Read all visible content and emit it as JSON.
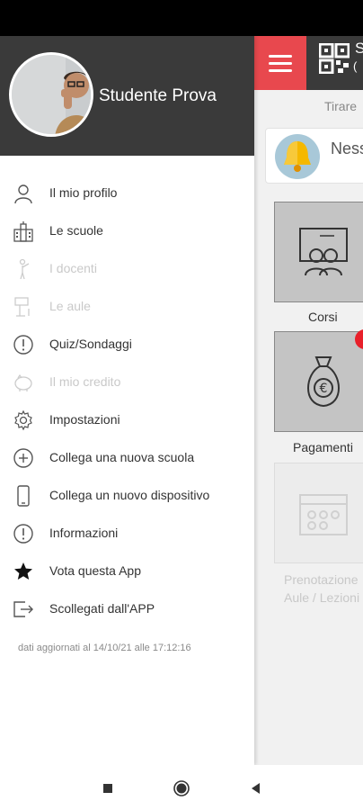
{
  "drawer": {
    "user_name": "Studente Prova",
    "items": [
      {
        "label": "Il mio profilo",
        "icon": "user-icon",
        "enabled": true
      },
      {
        "label": "Le scuole",
        "icon": "school-icon",
        "enabled": true
      },
      {
        "label": "I docenti",
        "icon": "teacher-icon",
        "enabled": false
      },
      {
        "label": "Le aule",
        "icon": "classroom-icon",
        "enabled": false
      },
      {
        "label": "Quiz/Sondaggi",
        "icon": "info-circle-icon",
        "enabled": true
      },
      {
        "label": "Il mio credito",
        "icon": "piggy-bank-icon",
        "enabled": false
      },
      {
        "label": "Impostazioni",
        "icon": "gear-icon",
        "enabled": true
      },
      {
        "label": "Collega una nuova scuola",
        "icon": "plus-circle-icon",
        "enabled": true
      },
      {
        "label": "Collega un nuovo dispositivo",
        "icon": "phone-icon",
        "enabled": true
      },
      {
        "label": "Informazioni",
        "icon": "info-circle-icon",
        "enabled": true
      },
      {
        "label": "Vota questa App",
        "icon": "star-icon",
        "enabled": true
      },
      {
        "label": "Scollegati dall'APP",
        "icon": "logout-icon",
        "enabled": true
      }
    ],
    "updated_text": "dati aggiornati al 14/10/21 alle 17:12:16"
  },
  "app": {
    "header_title": "S",
    "header_sub": "(",
    "pull_text": "Tirare",
    "notification_text": "Ness",
    "tiles": [
      {
        "label": "Corsi",
        "icon": "course-board-icon",
        "enabled": true
      },
      {
        "label": "Pagamenti",
        "icon": "money-bag-icon",
        "enabled": true
      },
      {
        "label_line1": "Prenotazione",
        "label_line2": "Aule / Lezioni",
        "icon": "calendar-icon",
        "enabled": false
      }
    ]
  },
  "colors": {
    "header_dark": "#3a3a3a",
    "accent_red": "#e8484e",
    "badge_red": "#e8202a"
  }
}
